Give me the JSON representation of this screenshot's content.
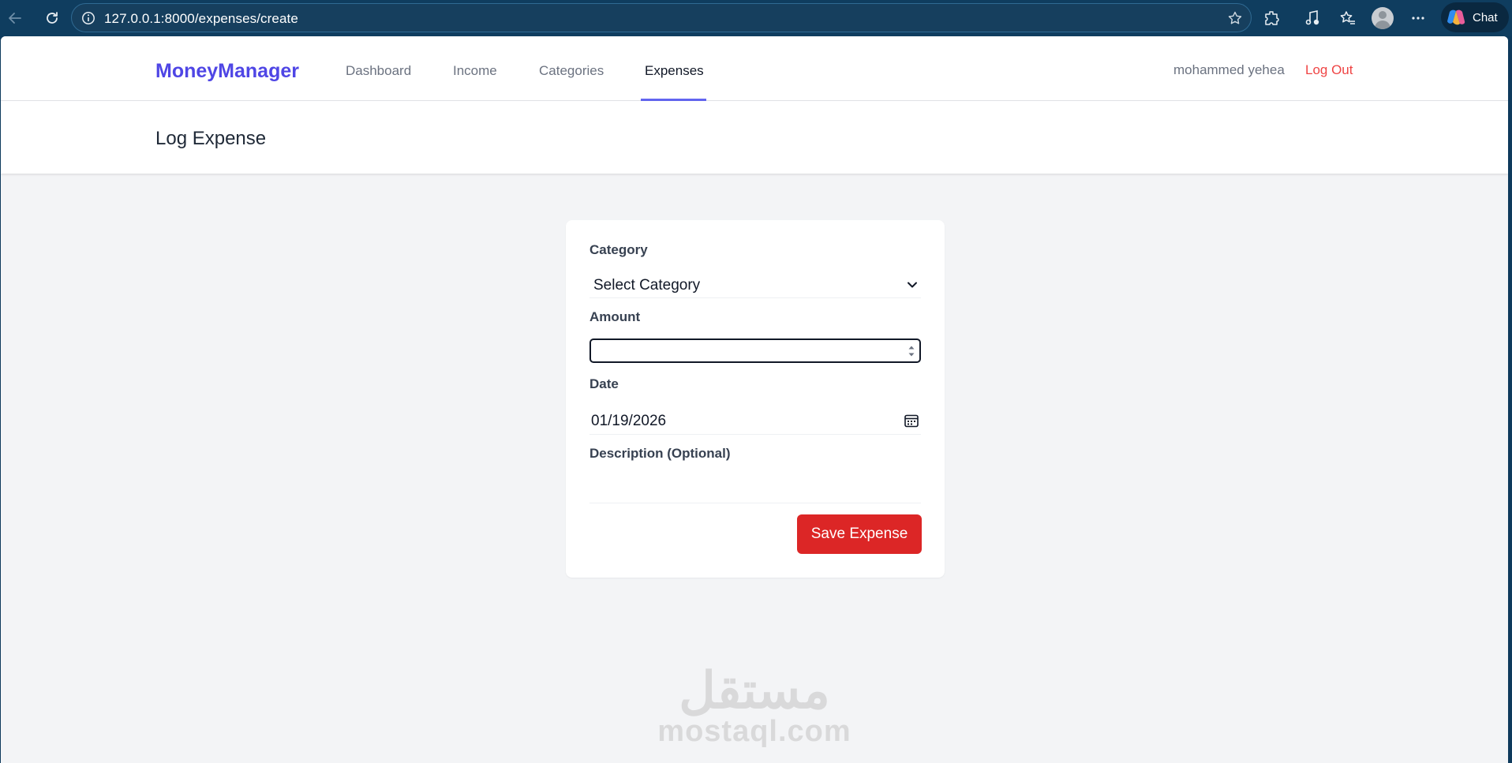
{
  "browser": {
    "url": "127.0.0.1:8000/expenses/create",
    "chat_label": "Chat"
  },
  "nav": {
    "brand": "MoneyManager",
    "links": [
      "Dashboard",
      "Income",
      "Categories",
      "Expenses"
    ],
    "active": "Expenses",
    "user": "mohammed yehea",
    "logout": "Log Out"
  },
  "page": {
    "title": "Log Expense"
  },
  "form": {
    "category_label": "Category",
    "category_value": "Select Category",
    "amount_label": "Amount",
    "amount_value": "",
    "date_label": "Date",
    "date_value": "01/19/2026",
    "description_label": "Description (Optional)",
    "description_value": "",
    "submit_label": "Save Expense"
  },
  "watermark": {
    "arabic": "مستقل",
    "latin": "mostaql.com"
  },
  "colors": {
    "brand": "#4f46e5",
    "active_underline": "#6366f1",
    "logout": "#ef4444",
    "save_button": "#dc2626",
    "browser_bar": "#0f3d5f"
  }
}
